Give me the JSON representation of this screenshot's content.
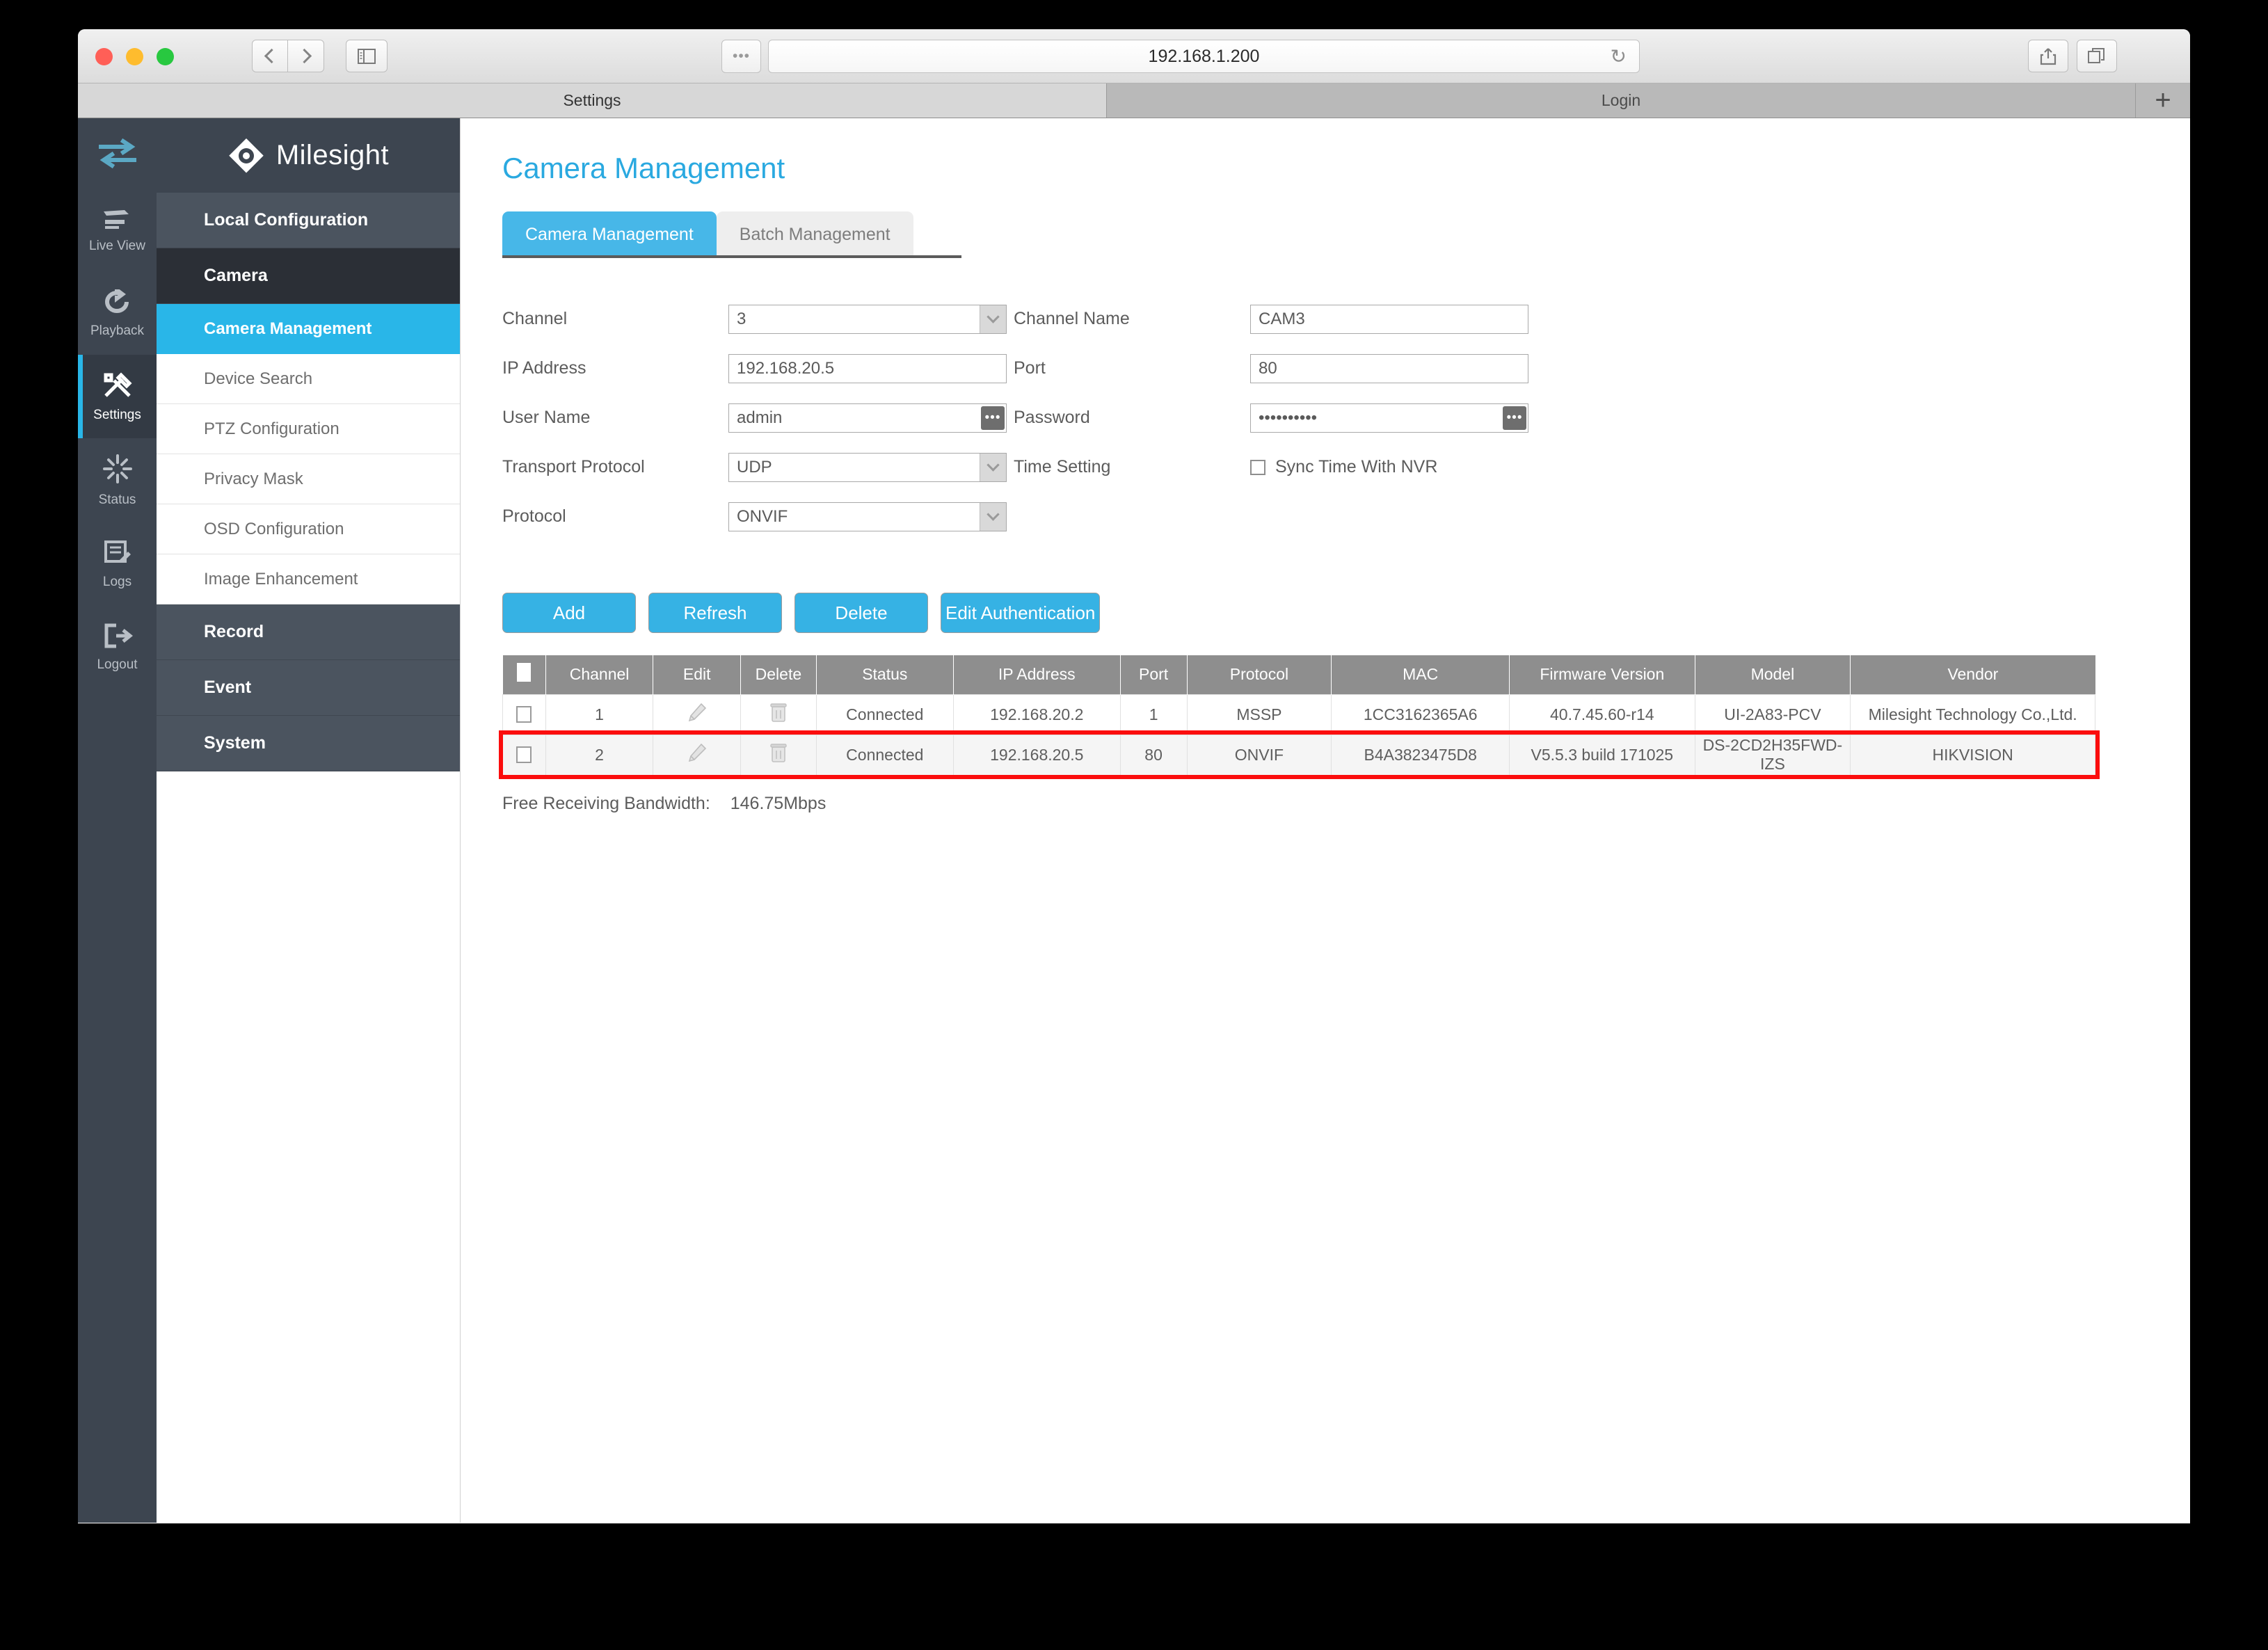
{
  "browser": {
    "url": "192.168.1.200",
    "url_prefix_icon": "more-icon",
    "reload_icon": "↻",
    "back_icon": "chevron-left-icon",
    "forward_icon": "chevron-right-icon",
    "sidebar_icon": "sidebar-toggle-icon",
    "share_icon": "share-icon",
    "tabs_overview_icon": "tabs-overview-icon",
    "new_tab_label": "+",
    "tabs": [
      {
        "label": "Settings",
        "active": true
      },
      {
        "label": "Login",
        "active": false
      }
    ]
  },
  "rail": {
    "items": [
      {
        "label": "",
        "icon": "transfer-arrows-icon",
        "active": false
      },
      {
        "label": "Live View",
        "icon": "live-view-icon",
        "active": false
      },
      {
        "label": "Playback",
        "icon": "playback-icon",
        "active": false
      },
      {
        "label": "Settings",
        "icon": "tools-icon",
        "active": true
      },
      {
        "label": "Status",
        "icon": "status-burst-icon",
        "active": false
      },
      {
        "label": "Logs",
        "icon": "logs-icon",
        "active": false
      },
      {
        "label": "Logout",
        "icon": "logout-icon",
        "active": false
      }
    ]
  },
  "sidebar": {
    "brand": "Milesight",
    "brand_icon": "milesight-diamond-logo",
    "local_configuration": "Local Configuration",
    "camera_group": "Camera",
    "camera_items": [
      {
        "label": "Camera Management",
        "active": true
      },
      {
        "label": "Device Search",
        "active": false
      },
      {
        "label": "PTZ Configuration",
        "active": false
      },
      {
        "label": "Privacy Mask",
        "active": false
      },
      {
        "label": "OSD Configuration",
        "active": false
      },
      {
        "label": "Image Enhancement",
        "active": false
      }
    ],
    "groups": [
      {
        "label": "Record"
      },
      {
        "label": "Event"
      },
      {
        "label": "System"
      }
    ]
  },
  "content": {
    "title": "Camera Management",
    "tabs": [
      {
        "label": "Camera Management",
        "active": true
      },
      {
        "label": "Batch Management",
        "active": false
      }
    ],
    "form": {
      "channel_label": "Channel",
      "channel_value": "3",
      "channel_name_label": "Channel Name",
      "channel_name_value": "CAM3",
      "ip_address_label": "IP Address",
      "ip_address_value": "192.168.20.5",
      "port_label": "Port",
      "port_value": "80",
      "user_name_label": "User Name",
      "user_name_value": "admin",
      "user_name_dots": "•••",
      "password_label": "Password",
      "password_value": "••••••••••",
      "password_dots": "•••",
      "transport_protocol_label": "Transport Protocol",
      "transport_protocol_value": "UDP",
      "time_setting_label": "Time Setting",
      "sync_time_label": "Sync Time With NVR",
      "sync_time_checked": false,
      "protocol_label": "Protocol",
      "protocol_value": "ONVIF"
    },
    "buttons": [
      {
        "label": "Add",
        "name": "add-button"
      },
      {
        "label": "Refresh",
        "name": "refresh-button"
      },
      {
        "label": "Delete",
        "name": "delete-button"
      },
      {
        "label": "Edit Authentication",
        "name": "edit-authentication-button"
      }
    ],
    "table": {
      "columns": [
        "",
        "Channel",
        "Edit",
        "Delete",
        "Status",
        "IP Address",
        "Port",
        "Protocol",
        "MAC",
        "Firmware Version",
        "Model",
        "Vendor"
      ],
      "rows": [
        {
          "channel": "1",
          "edit_icon": "pencil-icon",
          "delete_icon": "trash-icon",
          "status": "Connected",
          "ip": "192.168.20.2",
          "port": "1",
          "protocol": "MSSP",
          "mac": "1CC3162365A6",
          "firmware": "40.7.45.60-r14",
          "model": "UI-2A83-PCV",
          "vendor": "Milesight Technology Co.,Ltd.",
          "highlighted": false
        },
        {
          "channel": "2",
          "edit_icon": "pencil-icon",
          "delete_icon": "trash-icon",
          "status": "Connected",
          "ip": "192.168.20.5",
          "port": "80",
          "protocol": "ONVIF",
          "mac": "B4A3823475D8",
          "firmware": "V5.5.3 build 171025",
          "model": "DS-2CD2H35FWD-IZS",
          "vendor": "HIKVISION",
          "highlighted": true
        }
      ]
    },
    "bandwidth_label": "Free Receiving Bandwidth:",
    "bandwidth_value": "146.75Mbps"
  },
  "colors": {
    "accent": "#29b6e8",
    "title": "#2aa9e0",
    "sidebar_dark": "#3d4550",
    "highlight": "#fb0d0d",
    "table_header": "#8e8e8e"
  }
}
